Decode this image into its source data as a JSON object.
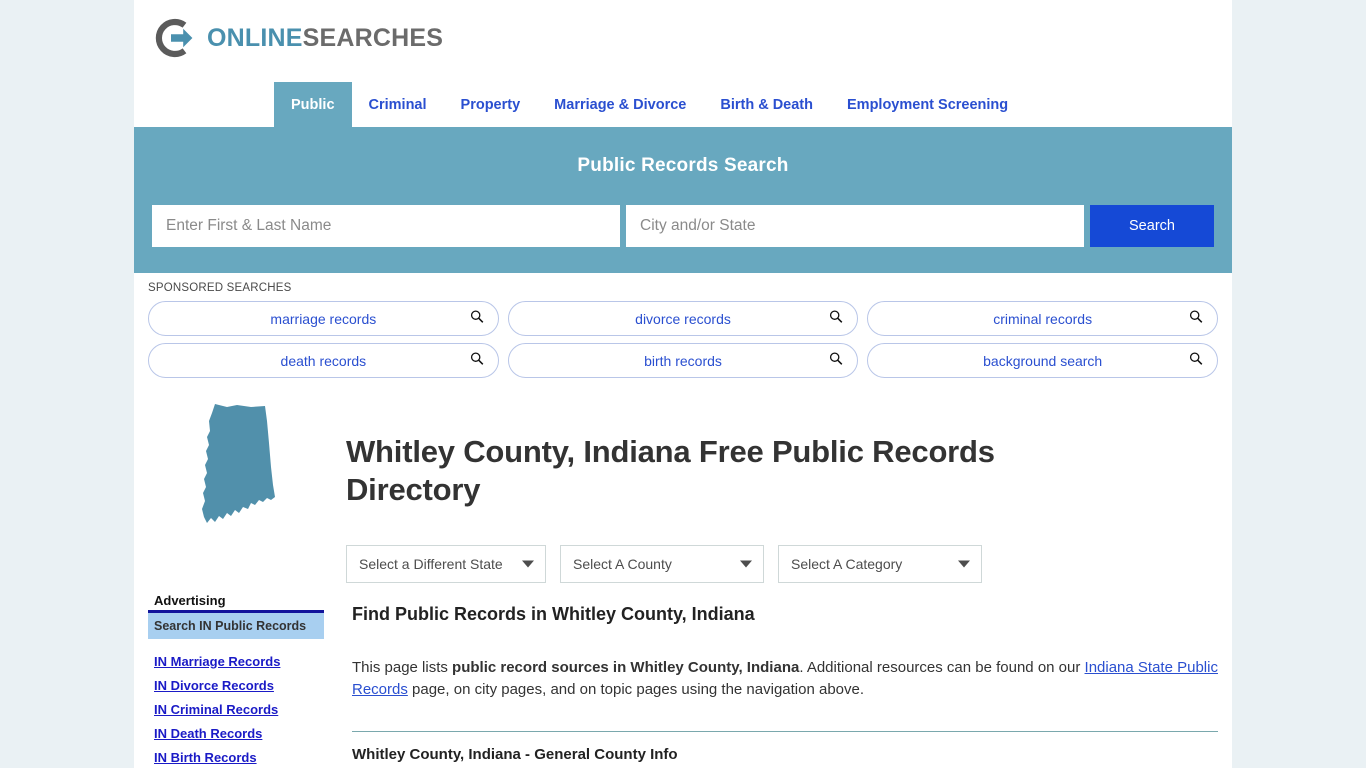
{
  "brand": {
    "logo_icon": "circle-arrow-logo-icon",
    "name_part1": "ONLINE",
    "name_part2": "SEARCHES",
    "accent_color": "#4a90ae",
    "gray_color": "#6b6b6b"
  },
  "nav": {
    "tabs": [
      {
        "label": "Public",
        "active": true
      },
      {
        "label": "Criminal",
        "active": false
      },
      {
        "label": "Property",
        "active": false
      },
      {
        "label": "Marriage & Divorce",
        "active": false
      },
      {
        "label": "Birth & Death",
        "active": false
      },
      {
        "label": "Employment Screening",
        "active": false
      }
    ],
    "active_bg": "#68a8bf",
    "link_color": "#2a4fd0"
  },
  "banner": {
    "title": "Public Records Search",
    "bg_color": "#68a8bf",
    "name_placeholder": "Enter First & Last Name",
    "name_value": "",
    "location_placeholder": "City and/or State",
    "location_value": "",
    "search_label": "Search",
    "search_button_color": "#1549d6"
  },
  "sponsored": {
    "label": "SPONSORED SEARCHES",
    "search_icon": "magnifier-icon",
    "row1": [
      {
        "label": "marriage records"
      },
      {
        "label": "divorce records"
      },
      {
        "label": "criminal records"
      }
    ],
    "row2": [
      {
        "label": "death records"
      },
      {
        "label": "birth records"
      },
      {
        "label": "background search"
      }
    ]
  },
  "hero": {
    "state_map_icon": "indiana-state-map-icon",
    "state_map_color": "#5190ab",
    "title": "Whitley County, Indiana Free Public Records Directory"
  },
  "selects": [
    {
      "name": "state",
      "value": "Select a Different State"
    },
    {
      "name": "county",
      "value": "Select A County"
    },
    {
      "name": "category",
      "value": "Select A Category"
    }
  ],
  "sidebar": {
    "heading": "Advertising",
    "box_label": "Search IN Public Records",
    "box_color": "#a8cff0",
    "links": [
      {
        "label": "IN Marriage Records"
      },
      {
        "label": "IN Divorce Records"
      },
      {
        "label": "IN Criminal Records"
      },
      {
        "label": "IN Death Records"
      },
      {
        "label": "IN Birth Records"
      }
    ]
  },
  "main": {
    "section_title": "Find Public Records in Whitley County, Indiana",
    "paragraph": {
      "lead": "This page lists ",
      "bold": "public record sources in Whitley County, Indiana",
      "mid": ". Additional resources can be found on our ",
      "link": "Indiana State Public Records",
      "tail": " page, on city pages, and on topic pages using the navigation above."
    },
    "sub_heading": "Whitley County, Indiana - General County Info"
  }
}
